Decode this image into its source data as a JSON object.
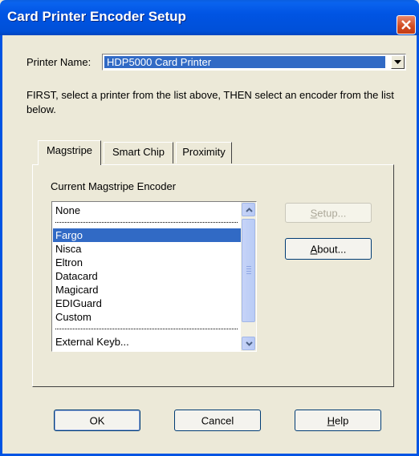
{
  "window": {
    "title": "Card Printer Encoder Setup"
  },
  "printer": {
    "label": "Printer Name:",
    "selected": "HDP5000 Card Printer"
  },
  "instructions": "FIRST, select a printer from the list above, THEN select an encoder from the list below.",
  "tabs": [
    {
      "label": "Magstripe",
      "active": true
    },
    {
      "label": "Smart Chip",
      "active": false
    },
    {
      "label": "Proximity",
      "active": false
    }
  ],
  "panel": {
    "encoder_label": "Current Magstripe Encoder",
    "list": {
      "items": [
        {
          "label": "None",
          "type": "item",
          "selected": false
        },
        {
          "label": "",
          "type": "separator"
        },
        {
          "label": "Fargo",
          "type": "item",
          "selected": true
        },
        {
          "label": "Nisca",
          "type": "item",
          "selected": false
        },
        {
          "label": "Eltron",
          "type": "item",
          "selected": false
        },
        {
          "label": "Datacard",
          "type": "item",
          "selected": false
        },
        {
          "label": "Magicard",
          "type": "item",
          "selected": false
        },
        {
          "label": "EDIGuard",
          "type": "item",
          "selected": false
        },
        {
          "label": "Custom",
          "type": "item",
          "selected": false
        },
        {
          "label": "",
          "type": "separator"
        },
        {
          "label": "External Keyb...",
          "type": "item",
          "selected": false
        }
      ]
    },
    "setup_button": {
      "prefix": "",
      "accel": "S",
      "rest": "etup...",
      "enabled": false
    },
    "about_button": {
      "prefix": "",
      "accel": "A",
      "rest": "bout...",
      "enabled": true
    }
  },
  "footer": {
    "ok": "OK",
    "cancel": "Cancel",
    "help": {
      "accel": "H",
      "rest": "elp"
    }
  },
  "colors": {
    "titlebar": "#0054e3",
    "selection": "#316ac5",
    "face": "#ece9d8"
  }
}
